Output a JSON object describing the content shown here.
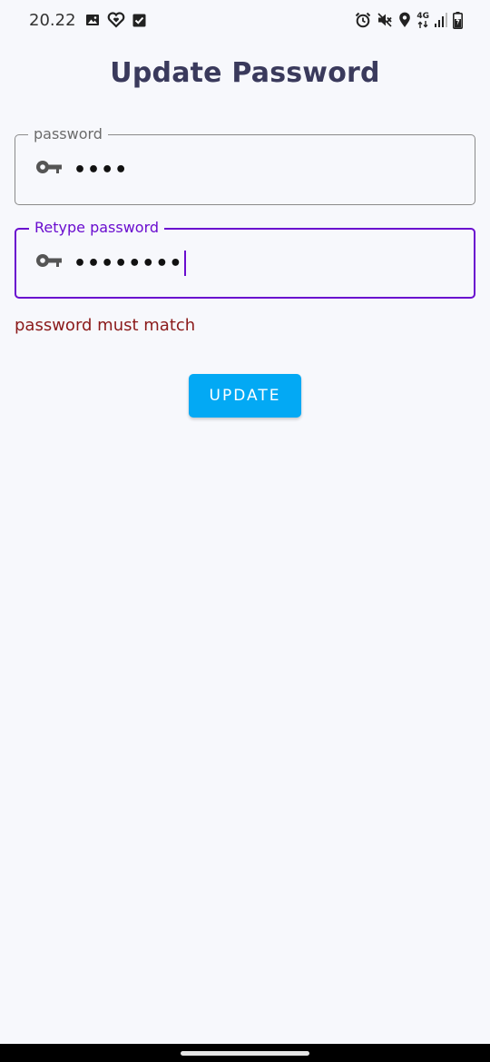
{
  "status_bar": {
    "time": "20.22",
    "network": "4G",
    "icons": [
      "image-icon",
      "heart-icon",
      "checkbox-icon",
      "alarm-icon",
      "mute-icon",
      "location-icon",
      "data-arrows-icon",
      "signal-icon",
      "battery-charging-icon"
    ]
  },
  "page": {
    "title": "Update Password"
  },
  "form": {
    "password": {
      "label": "password",
      "value": "••••",
      "icon": "key-icon"
    },
    "retype_password": {
      "label": "Retype password",
      "value": "••••••••",
      "icon": "key-icon"
    },
    "error": "password must match",
    "submit_label": "UPDATE"
  },
  "colors": {
    "background": "#f7f8fc",
    "title": "#3a3a5c",
    "focus_accent": "#6a0dcf",
    "error": "#8b1a1a",
    "button": "#03a9f4"
  }
}
